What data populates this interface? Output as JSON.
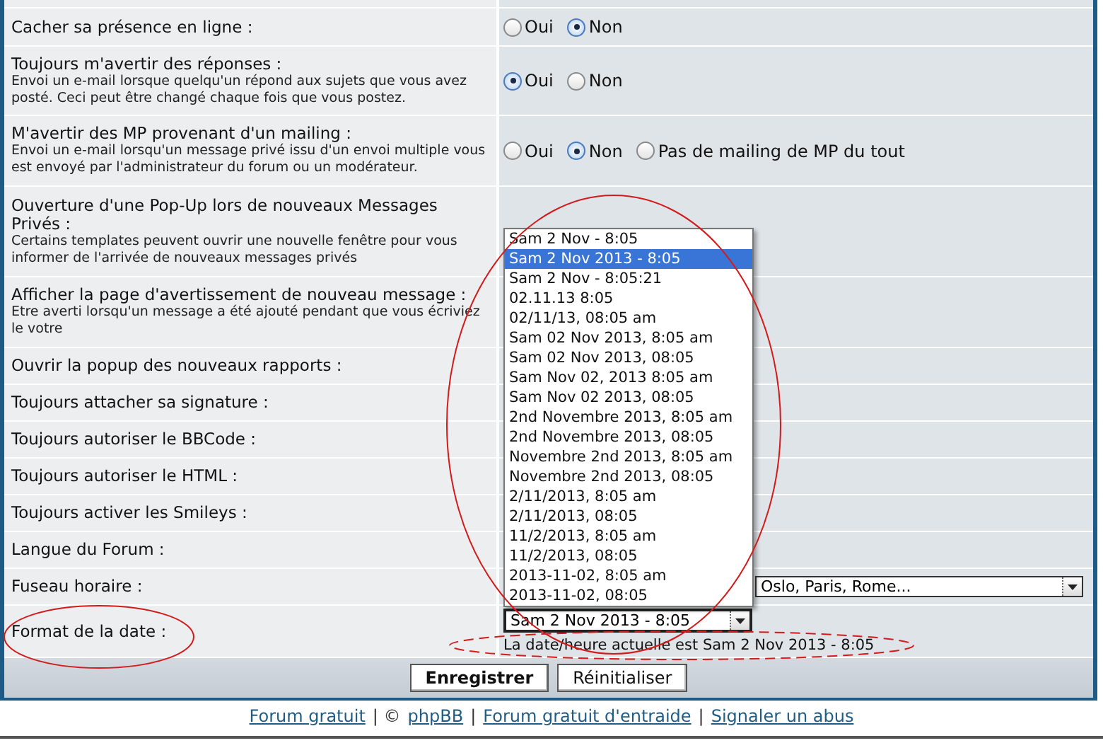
{
  "settings": [
    {
      "kind": "blank"
    },
    {
      "kind": "radios",
      "label": "Cacher sa présence en ligne :",
      "options": [
        {
          "label": "Oui",
          "selected": false
        },
        {
          "label": "Non",
          "selected": true
        }
      ]
    },
    {
      "kind": "radios",
      "label": "Toujours m'avertir des réponses :",
      "description": "Envoi un e-mail lorsque quelqu'un répond aux sujets que vous avez posté. Ceci peut être changé chaque fois que vous postez.",
      "options": [
        {
          "label": "Oui",
          "selected": true
        },
        {
          "label": "Non",
          "selected": false
        }
      ]
    },
    {
      "kind": "radios",
      "label": "M'avertir des MP provenant d'un mailing :",
      "description": "Envoi un e-mail lorsqu'un message privé issu d'un envoi multiple vous est envoyé par l'administrateur du forum ou un modérateur.",
      "options": [
        {
          "label": "Oui",
          "selected": false
        },
        {
          "label": "Non",
          "selected": true
        },
        {
          "label": "Pas de mailing de MP du tout",
          "selected": false
        }
      ]
    },
    {
      "kind": "blank",
      "label": "Ouverture d'une Pop-Up lors de nouveaux Messages Privés :",
      "description": "Certains templates peuvent ouvrir une nouvelle fenêtre pour vous informer de l'arrivée de nouveaux messages privés"
    },
    {
      "kind": "blank",
      "label": "Afficher la page d'avertissement de nouveau message :",
      "description": "Etre averti lorsqu'un message a été ajouté pendant que vous écriviez le votre"
    },
    {
      "kind": "blank",
      "label": "Ouvrir la popup des nouveaux rapports :"
    },
    {
      "kind": "blank",
      "label": "Toujours attacher sa signature :"
    },
    {
      "kind": "blank",
      "label": "Toujours autoriser le BBCode :"
    },
    {
      "kind": "blank",
      "label": "Toujours autoriser le HTML :"
    },
    {
      "kind": "blank",
      "label": "Toujours activer les Smileys :"
    },
    {
      "kind": "blank",
      "label": "Langue du Forum :"
    },
    {
      "kind": "select",
      "label": "Fuseau horaire :",
      "value": "Oslo, Paris, Rome..."
    },
    {
      "kind": "date",
      "label": "Format de la date :",
      "value": "Sam 2 Nov 2013 - 8:05",
      "note": "La date/heure actuelle est Sam 2 Nov 2013 - 8:05"
    }
  ],
  "date_dropdown": [
    {
      "label": "Sam 2 Nov - 8:05",
      "selected": false
    },
    {
      "label": "Sam 2 Nov 2013 - 8:05",
      "selected": true
    },
    {
      "label": "Sam 2 Nov - 8:05:21",
      "selected": false
    },
    {
      "label": "02.11.13 8:05",
      "selected": false
    },
    {
      "label": "02/11/13, 08:05 am",
      "selected": false
    },
    {
      "label": "Sam 02 Nov 2013, 8:05 am",
      "selected": false
    },
    {
      "label": "Sam 02 Nov 2013, 08:05",
      "selected": false
    },
    {
      "label": "Sam Nov 02, 2013 8:05 am",
      "selected": false
    },
    {
      "label": "Sam Nov 02 2013, 08:05",
      "selected": false
    },
    {
      "label": "2nd Novembre 2013, 8:05 am",
      "selected": false
    },
    {
      "label": "2nd Novembre 2013, 08:05",
      "selected": false
    },
    {
      "label": "Novembre 2nd 2013, 8:05 am",
      "selected": false
    },
    {
      "label": "Novembre 2nd 2013, 08:05",
      "selected": false
    },
    {
      "label": "2/11/2013, 8:05 am",
      "selected": false
    },
    {
      "label": "2/11/2013, 08:05",
      "selected": false
    },
    {
      "label": "11/2/2013, 8:05 am",
      "selected": false
    },
    {
      "label": "11/2/2013, 08:05",
      "selected": false
    },
    {
      "label": "2013-11-02, 8:05 am",
      "selected": false
    },
    {
      "label": "2013-11-02, 08:05",
      "selected": false
    }
  ],
  "buttons": [
    {
      "kind": "primary",
      "label": "Enregistrer"
    },
    {
      "kind": "secondary",
      "label": "Réinitialiser"
    }
  ],
  "footer": [
    {
      "kind": "link",
      "text": "Forum gratuit"
    },
    {
      "kind": "text",
      "text": "| ©"
    },
    {
      "kind": "link",
      "text": "phpBB"
    },
    {
      "kind": "text",
      "text": "|"
    },
    {
      "kind": "link",
      "text": "Forum gratuit d'entraide"
    },
    {
      "kind": "text",
      "text": "|"
    },
    {
      "kind": "link",
      "text": "Signaler un abus"
    }
  ]
}
